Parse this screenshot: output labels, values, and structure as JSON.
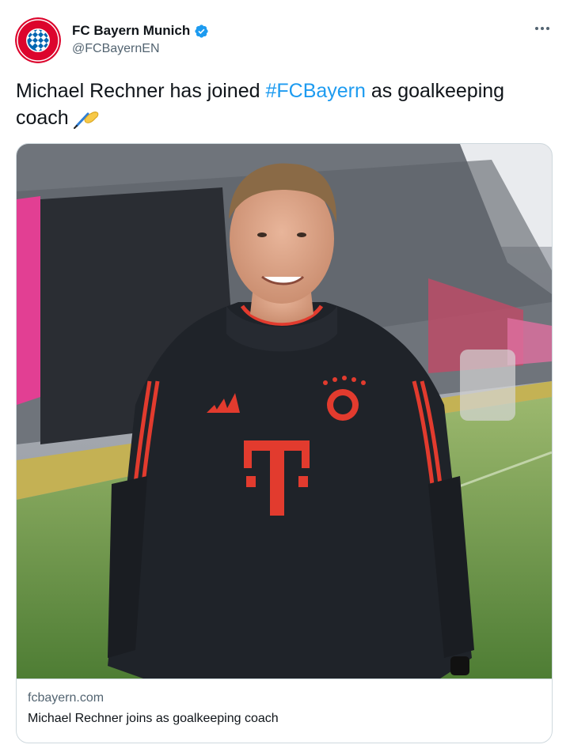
{
  "tweet": {
    "author": {
      "display_name": "FC Bayern Munich",
      "handle": "@FCBayernEN",
      "avatar_icon": "fc-bayern-crest-icon",
      "verified_icon": "verified-badge-icon",
      "verified_color": "#1d9bf0"
    },
    "more_icon": "more-options-icon",
    "text": {
      "before": "Michael Rechner has joined ",
      "hashtag": "#FCBayern",
      "after": " as goalkeeping coach",
      "emoji_icon": "writing-hand-emoji"
    },
    "card": {
      "image_alt": "Michael Rechner in FC Bayern training top",
      "domain": "fcbayern.com",
      "title": "Michael Rechner joins as goalkeeping coach"
    }
  },
  "colors": {
    "link": "#1d9bf0",
    "text_primary": "#0f1419",
    "text_secondary": "#536471",
    "border": "#cfd9de",
    "bayern_red": "#dc052d",
    "telekom_magenta": "#e20074"
  }
}
